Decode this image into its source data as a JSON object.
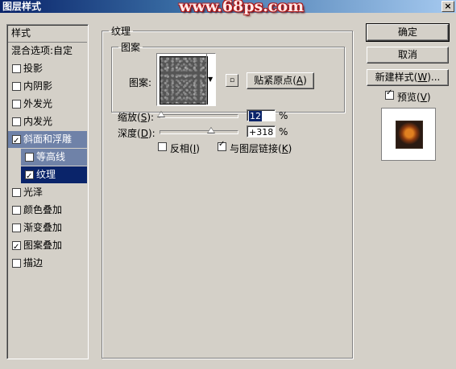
{
  "window": {
    "title": "图层样式",
    "watermark": "www.68ps.com",
    "close_glyph": "×"
  },
  "sidebar": {
    "header": "样式",
    "items": [
      {
        "label": "混合选项:自定",
        "checkbox": false,
        "checked": false,
        "state": "normal"
      },
      {
        "label": "投影",
        "checkbox": true,
        "checked": false,
        "state": "normal"
      },
      {
        "label": "内阴影",
        "checkbox": true,
        "checked": false,
        "state": "normal"
      },
      {
        "label": "外发光",
        "checkbox": true,
        "checked": false,
        "state": "normal"
      },
      {
        "label": "内发光",
        "checkbox": true,
        "checked": false,
        "state": "normal"
      },
      {
        "label": "斜面和浮雕",
        "checkbox": true,
        "checked": true,
        "state": "highlighted"
      },
      {
        "label": "等高线",
        "checkbox": true,
        "checked": false,
        "state": "highlighted"
      },
      {
        "label": "纹理",
        "checkbox": true,
        "checked": true,
        "state": "selected"
      },
      {
        "label": "光泽",
        "checkbox": true,
        "checked": false,
        "state": "normal"
      },
      {
        "label": "颜色叠加",
        "checkbox": true,
        "checked": false,
        "state": "normal"
      },
      {
        "label": "渐变叠加",
        "checkbox": true,
        "checked": false,
        "state": "normal"
      },
      {
        "label": "图案叠加",
        "checkbox": true,
        "checked": true,
        "state": "normal"
      },
      {
        "label": "描边",
        "checkbox": true,
        "checked": false,
        "state": "normal"
      }
    ]
  },
  "texture": {
    "group_title": "纹理",
    "pattern_group_title": "图案",
    "pattern_label": "图案:",
    "snap_origin_button": {
      "prefix": "贴紧原点(",
      "key": "A",
      "suffix": ")"
    },
    "scale": {
      "label_prefix": "缩放(",
      "key": "S",
      "label_suffix": "):",
      "value": "12",
      "unit": "%",
      "slider_value": 12
    },
    "depth": {
      "label_prefix": "深度(",
      "key": "D",
      "label_suffix": "):",
      "value": "+318",
      "unit": "%",
      "slider_value": 318
    },
    "invert": {
      "prefix": "反相(",
      "key": "I",
      "suffix": ")",
      "checked": false
    },
    "link_with_layer": {
      "prefix": "与图层链接(",
      "key": "K",
      "suffix": ")",
      "checked": true
    }
  },
  "buttons": {
    "ok": "确定",
    "cancel": "取消",
    "new_style": {
      "prefix": "新建样式(",
      "key": "W",
      "suffix": ")..."
    },
    "preview": {
      "prefix": "预览(",
      "key": "V",
      "suffix": ")",
      "checked": true
    }
  },
  "colors": {
    "title_bar_start": "#0a246a",
    "selection": "#0a246a",
    "highlight": "#6f82a8",
    "dialog_bg": "#d4d0c8",
    "watermark_red": "#b01818"
  },
  "icons": {
    "pattern_dropdown": "triangle-down-icon",
    "new_preset": "new-preset-icon"
  }
}
